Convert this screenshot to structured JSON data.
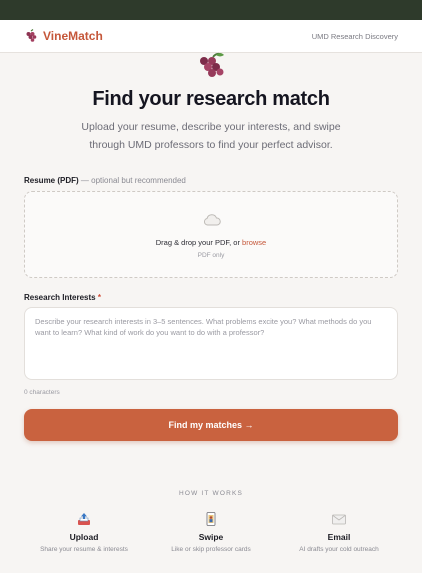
{
  "brand": {
    "name": "VineMatch",
    "accent": "#c5573a"
  },
  "nav": {
    "right_text": "UMD Research Discovery"
  },
  "hero": {
    "title": "Find your research match",
    "subtitle": "Upload your resume, describe your interests, and swipe through UMD professors to find your perfect advisor."
  },
  "resume": {
    "label": "Resume (PDF)",
    "hint": "— optional but recommended",
    "drop_text": "Drag & drop your PDF, or",
    "browse_text": "browse",
    "sub_text": "PDF only"
  },
  "interests": {
    "label": "Research Interests",
    "required_mark": "*",
    "placeholder": "Describe your research interests in 3–5 sentences. What problems excite you? What methods do you want to learn? What kind of work do you want to do with a professor?",
    "char_count": "0 characters"
  },
  "cta": {
    "label": "Find my matches →",
    "color": "#c9623f"
  },
  "how_it_works": {
    "title": "HOW IT WORKS",
    "steps": [
      {
        "icon": "upload-tray-icon",
        "title": "Upload",
        "desc": "Share your resume & interests"
      },
      {
        "icon": "playing-card-icon",
        "title": "Swipe",
        "desc": "Like or skip professor cards"
      },
      {
        "icon": "envelope-icon",
        "title": "Email",
        "desc": "AI drafts your cold outreach"
      }
    ]
  }
}
